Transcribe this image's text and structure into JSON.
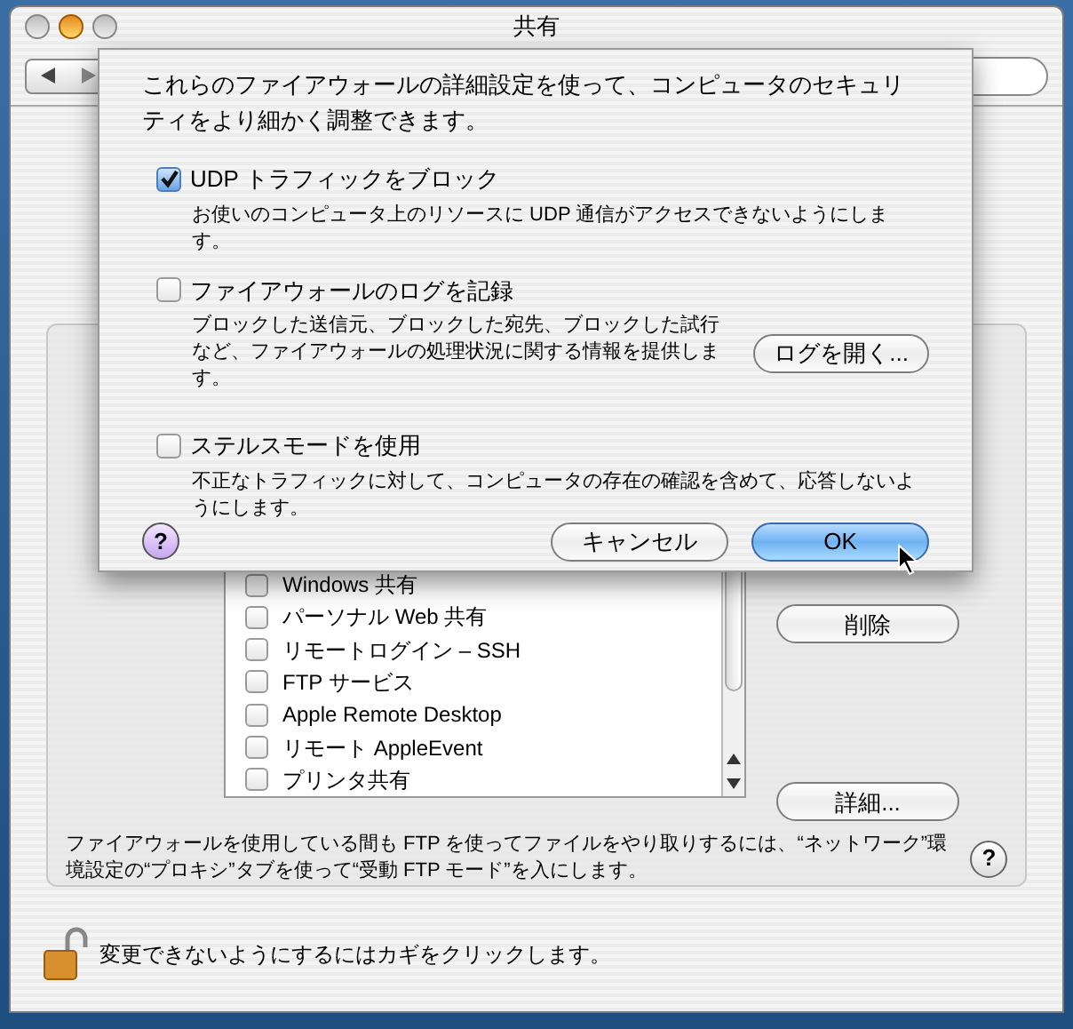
{
  "window": {
    "title": "共有"
  },
  "sheet": {
    "intro": "これらのファイアウォールの詳細設定を使って、コンピュータのセキュリティをより細かく調整できます。",
    "options": [
      {
        "label": "UDP トラフィックをブロック",
        "description": "お使いのコンピュータ上のリソースに UDP 通信がアクセスできないようにします。",
        "checked": true
      },
      {
        "label": "ファイアウォールのログを記録",
        "description": "ブロックした送信元、ブロックした宛先、ブロックした試行など、ファイアウォールの処理状況に関する情報を提供します。",
        "checked": false,
        "button": "ログを開く..."
      },
      {
        "label": "ステルスモードを使用",
        "description": "不正なトラフィックに対して、コンピュータの存在の確認を含めて、応答しないようにします。",
        "checked": false
      }
    ],
    "help": "?",
    "buttons": [
      {
        "label": "キャンセル",
        "default": false
      },
      {
        "label": "OK",
        "default": true
      }
    ]
  },
  "services": [
    {
      "name": "Windows 共有",
      "checked": false
    },
    {
      "name": "パーソナル Web 共有",
      "checked": false
    },
    {
      "name": "リモートログイン – SSH",
      "checked": false
    },
    {
      "name": "FTP サービス",
      "checked": false
    },
    {
      "name": "Apple Remote Desktop",
      "checked": false
    },
    {
      "name": "リモート AppleEvent",
      "checked": false
    },
    {
      "name": "プリンタ共有",
      "checked": false
    }
  ],
  "side_buttons": [
    "削除",
    "詳細..."
  ],
  "note": "ファイアウォールを使用している間も FTP を使ってファイルをやり取りするには、“ネットワーク”環境設定の“プロキシ”タブを使って“受動 FTP モード”を入にします。",
  "help": "?",
  "lock_text": "変更できないようにするにはカギをクリックします。"
}
